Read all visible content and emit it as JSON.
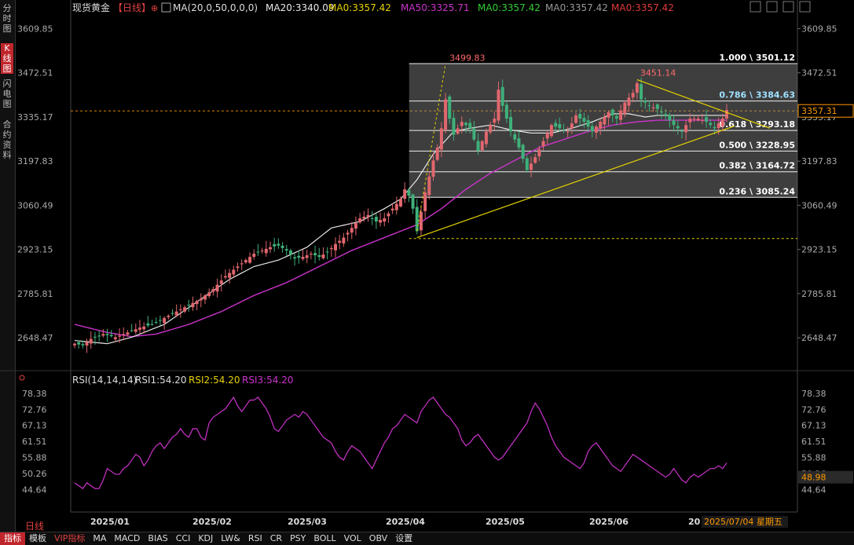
{
  "sidebar": {
    "tabs": [
      {
        "label": "分时图",
        "active": false
      },
      {
        "label": "K线图",
        "active": true
      },
      {
        "label": "闪电图",
        "active": false
      },
      {
        "label": "合约资料",
        "active": false
      }
    ]
  },
  "header": {
    "symbol": "现货黄金",
    "period_tag": "【日线】",
    "ma_label": "MA(20,0,50,0,0,0)",
    "ma20": "MA20:3340.09",
    "ma0a": "MA0:3357.42",
    "ma50": "MA50:3325.71",
    "ma0b": "MA0:3357.42",
    "ma0c": "MA0:3357.42",
    "ma0d": "MA0:3357.42",
    "colors": {
      "ma20": "#e8e8e8",
      "ma0a": "#e6d200",
      "ma50": "#cc33cc",
      "ma0b": "#33cc33",
      "ma0c": "#999999",
      "ma0d": "#e03a3a"
    }
  },
  "rsi_header": {
    "label": "RSI(14,14,14)",
    "rsi1": "RSI1:54.20",
    "rsi2": "RSI2:54.20",
    "rsi3": "RSI3:54.20"
  },
  "bottom": {
    "period": "日线",
    "tabs": [
      "指标",
      "模板",
      "VIP指标",
      "MA",
      "MACD",
      "BIAS",
      "CCI",
      "KDJ",
      "LW&",
      "RSI",
      "CR",
      "PSY",
      "BOLL",
      "VOL",
      "OBV",
      "设置"
    ]
  },
  "chart_data": [
    {
      "type": "candlestick",
      "title": "现货黄金",
      "y_ticks": [
        3609.85,
        3472.51,
        3335.17,
        3197.83,
        3060.49,
        2923.15,
        2785.81,
        2648.47
      ],
      "ylim": [
        2595,
        3650
      ],
      "x_ticks": [
        "2025/01",
        "2025/02",
        "2025/03",
        "2025/04",
        "2025/05",
        "2025/06"
      ],
      "current_price": "3357.31",
      "current_date": "2025/07/04 星期五",
      "partial_date_label": "2025/07",
      "ma20_keys": [
        [
          0,
          2640
        ],
        [
          8,
          2630
        ],
        [
          14,
          2650
        ],
        [
          22,
          2690
        ],
        [
          30,
          2760
        ],
        [
          38,
          2830
        ],
        [
          44,
          2870
        ],
        [
          50,
          2890
        ],
        [
          57,
          2930
        ],
        [
          63,
          2990
        ],
        [
          70,
          3010
        ],
        [
          76,
          3050
        ],
        [
          80,
          3080
        ],
        [
          84,
          3140
        ],
        [
          88,
          3220
        ],
        [
          93,
          3290
        ],
        [
          97,
          3300
        ],
        [
          102,
          3310
        ],
        [
          107,
          3295
        ],
        [
          112,
          3285
        ],
        [
          117,
          3285
        ],
        [
          122,
          3300
        ],
        [
          127,
          3320
        ],
        [
          132,
          3345
        ],
        [
          136,
          3345
        ],
        [
          140,
          3335
        ],
        [
          143,
          3340
        ]
      ],
      "ma50_keys": [
        [
          0,
          2690
        ],
        [
          8,
          2665
        ],
        [
          14,
          2652
        ],
        [
          20,
          2660
        ],
        [
          28,
          2690
        ],
        [
          36,
          2730
        ],
        [
          44,
          2780
        ],
        [
          52,
          2820
        ],
        [
          60,
          2870
        ],
        [
          68,
          2920
        ],
        [
          76,
          2960
        ],
        [
          84,
          3000
        ],
        [
          90,
          3050
        ],
        [
          96,
          3110
        ],
        [
          102,
          3160
        ],
        [
          108,
          3200
        ],
        [
          114,
          3240
        ],
        [
          120,
          3265
        ],
        [
          126,
          3290
        ],
        [
          132,
          3310
        ],
        [
          138,
          3320
        ],
        [
          143,
          3325
        ]
      ],
      "close_keys": [
        [
          0,
          2630
        ],
        [
          2,
          2625
        ],
        [
          4,
          2645
        ],
        [
          7,
          2660
        ],
        [
          10,
          2650
        ],
        [
          13,
          2665
        ],
        [
          16,
          2680
        ],
        [
          19,
          2690
        ],
        [
          22,
          2710
        ],
        [
          25,
          2730
        ],
        [
          28,
          2750
        ],
        [
          31,
          2770
        ],
        [
          34,
          2800
        ],
        [
          37,
          2840
        ],
        [
          40,
          2870
        ],
        [
          42,
          2890
        ],
        [
          44,
          2910
        ],
        [
          46,
          2920
        ],
        [
          48,
          2930
        ],
        [
          50,
          2935
        ],
        [
          52,
          2920
        ],
        [
          54,
          2895
        ],
        [
          56,
          2900
        ],
        [
          58,
          2910
        ],
        [
          60,
          2900
        ],
        [
          62,
          2915
        ],
        [
          64,
          2940
        ],
        [
          66,
          2960
        ],
        [
          68,
          2990
        ],
        [
          70,
          3020
        ],
        [
          72,
          3030
        ],
        [
          74,
          3010
        ],
        [
          76,
          3020
        ],
        [
          78,
          3050
        ],
        [
          80,
          3080
        ],
        [
          81,
          3110
        ],
        [
          82,
          3090
        ],
        [
          83,
          3050
        ],
        [
          84,
          2980
        ],
        [
          85,
          3040
        ],
        [
          86,
          3100
        ],
        [
          87,
          3150
        ],
        [
          88,
          3200
        ],
        [
          89,
          3240
        ],
        [
          90,
          3300
        ],
        [
          91,
          3390
        ],
        [
          92,
          3330
        ],
        [
          93,
          3280
        ],
        [
          95,
          3320
        ],
        [
          97,
          3300
        ],
        [
          99,
          3230
        ],
        [
          101,
          3290
        ],
        [
          103,
          3330
        ],
        [
          104,
          3420
        ],
        [
          105,
          3370
        ],
        [
          107,
          3290
        ],
        [
          109,
          3240
        ],
        [
          111,
          3170
        ],
        [
          113,
          3210
        ],
        [
          115,
          3260
        ],
        [
          117,
          3310
        ],
        [
          119,
          3300
        ],
        [
          121,
          3290
        ],
        [
          123,
          3340
        ],
        [
          125,
          3320
        ],
        [
          127,
          3290
        ],
        [
          129,
          3320
        ],
        [
          131,
          3350
        ],
        [
          133,
          3330
        ],
        [
          135,
          3380
        ],
        [
          137,
          3410
        ],
        [
          138,
          3440
        ],
        [
          139,
          3390
        ],
        [
          141,
          3370
        ],
        [
          143,
          3360
        ],
        [
          145,
          3340
        ],
        [
          147,
          3310
        ],
        [
          149,
          3290
        ],
        [
          151,
          3330
        ],
        [
          153,
          3330
        ],
        [
          155,
          3320
        ],
        [
          157,
          3300
        ],
        [
          159,
          3330
        ],
        [
          160,
          3357
        ]
      ],
      "annotations": {
        "high_1": "3499.83",
        "high_2": "3451.14"
      },
      "fibonacci": [
        {
          "ratio": "1.000",
          "value": 3501.12
        },
        {
          "ratio": "0.786",
          "value": 3384.63
        },
        {
          "ratio": "0.618",
          "value": 3293.18
        },
        {
          "ratio": "0.500",
          "value": 3228.95
        },
        {
          "ratio": "0.382",
          "value": 3164.72
        },
        {
          "ratio": "0.236",
          "value": 3085.24
        }
      ],
      "fib_label_sep": " \\ ",
      "fib_base_value": 2957,
      "dashed_level": 3354
    },
    {
      "type": "line",
      "title": "RSI(14,14,14)",
      "y_ticks": [
        78.38,
        72.76,
        67.13,
        61.51,
        55.88,
        50.26,
        44.64
      ],
      "ylim": [
        42,
        80
      ],
      "current_value": "48.98",
      "values": [
        47,
        46,
        45,
        47,
        46,
        45,
        45,
        48,
        52,
        51,
        50,
        50,
        52,
        53,
        55,
        57,
        56,
        53,
        55,
        58,
        60,
        61,
        59,
        61,
        63,
        64,
        66,
        64,
        63,
        66,
        66,
        63,
        62,
        68,
        70,
        71,
        72,
        73,
        75,
        77,
        74,
        72,
        74,
        76,
        76,
        77,
        75,
        73,
        70,
        66,
        65,
        67,
        69,
        70,
        71,
        70,
        72,
        71,
        69,
        67,
        65,
        63,
        62,
        61,
        58,
        56,
        55,
        58,
        60,
        59,
        58,
        56,
        54,
        52,
        55,
        58,
        61,
        63,
        66,
        67,
        69,
        71,
        70,
        69,
        68,
        72,
        74,
        76,
        77,
        75,
        73,
        71,
        70,
        68,
        66,
        62,
        60,
        61,
        63,
        64,
        62,
        60,
        58,
        56,
        55,
        56,
        58,
        60,
        62,
        64,
        66,
        68,
        72,
        75,
        73,
        70,
        67,
        63,
        60,
        58,
        56,
        55,
        54,
        53,
        52,
        54,
        58,
        60,
        61,
        59,
        57,
        55,
        53,
        52,
        51,
        53,
        55,
        57,
        56,
        55,
        54,
        53,
        52,
        51,
        50,
        49,
        50,
        52,
        50,
        48,
        47,
        49,
        50,
        49,
        50,
        51,
        52,
        52,
        53,
        52,
        54
      ]
    }
  ]
}
